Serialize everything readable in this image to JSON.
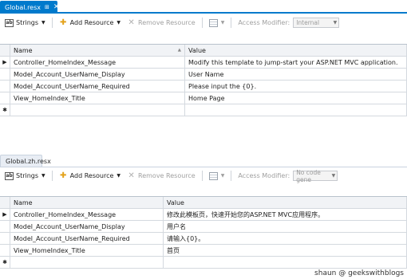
{
  "colors": {
    "active_tab": "#007acc",
    "inactive_tab": "#e8edf4",
    "grid_line": "#d4d9df",
    "header_bg": "#f1f3f6",
    "disabled_text": "#a0a0a0"
  },
  "panels": [
    {
      "tab": {
        "title": "Global.resx",
        "pin": "⊞",
        "close": "✕",
        "active": true
      },
      "toolbar": {
        "strings_label": "Strings",
        "add_resource_label": "Add Resource",
        "remove_resource_label": "Remove Resource",
        "access_modifier_label": "Access Modifier:",
        "access_modifier_value": "Internal"
      },
      "grid": {
        "columns": [
          "Name",
          "Value"
        ],
        "rows": [
          {
            "marker": "▶",
            "name": "Controller_HomeIndex_Message",
            "value": "Modify this template to jump-start your ASP.NET MVC application."
          },
          {
            "marker": "",
            "name": "Model_Account_UserName_Display",
            "value": "User Name"
          },
          {
            "marker": "",
            "name": "Model_Account_UserName_Required",
            "value": "Please input the {0}."
          },
          {
            "marker": "",
            "name": "View_HomeIndex_Title",
            "value": "Home Page"
          }
        ],
        "new_row_marker": "✱"
      }
    },
    {
      "tab": {
        "title": "Global.zh.resx",
        "pin": "",
        "close": "",
        "active": false
      },
      "toolbar": {
        "strings_label": "Strings",
        "add_resource_label": "Add Resource",
        "remove_resource_label": "Remove Resource",
        "access_modifier_label": "Access Modifier:",
        "access_modifier_value": "No code gene"
      },
      "grid": {
        "columns": [
          "Name",
          "Value"
        ],
        "rows": [
          {
            "marker": "▶",
            "name": "Controller_HomeIndex_Message",
            "value": "修改此模板页，快速开始您的ASP.NET MVC应用程序。"
          },
          {
            "marker": "",
            "name": "Model_Account_UserName_Display",
            "value": "用户名"
          },
          {
            "marker": "",
            "name": "Model_Account_UserName_Required",
            "value": "请输入{0}。"
          },
          {
            "marker": "",
            "name": "View_HomeIndex_Title",
            "value": "首页"
          }
        ],
        "new_row_marker": "✱"
      }
    }
  ],
  "watermark": "shaun @ geekswithblogs"
}
